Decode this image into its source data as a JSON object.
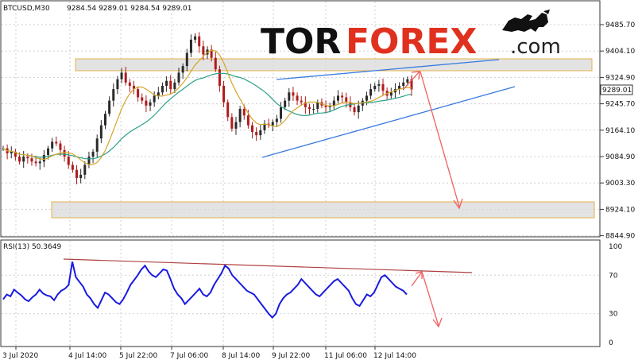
{
  "header": {
    "symbol_timeframe": "BTCUSD,M30",
    "ohlc": "9284.54 9289.01 9284.54 9289.01",
    "rsi_label": "RSI(13) 50.3649"
  },
  "logo": {
    "part1": "TOR",
    "part2": "FOREX",
    "part3": ".com"
  },
  "colors": {
    "candle_up": "#2a2a2a",
    "candle_down": "#b21a1a",
    "ma_fast": "#d4a52a",
    "ma_slow": "#2aa08a",
    "trendline": "#3b7be0",
    "forecast_arrow": "#f06060",
    "rsi_line": "#1a1ae0",
    "rsi_trendline": "#b04040",
    "zone_fill": "#d9d9d9",
    "zone_border": "#e3b04b",
    "logo_dark": "#111111",
    "logo_red": "#e0301e"
  },
  "current_price": "9289.01",
  "chart_data": [
    {
      "type": "line",
      "title": "BTCUSD,M30",
      "y_ticks": [
        "9485.70",
        "9404.10",
        "9324.90",
        "9245.70",
        "9164.10",
        "9084.90",
        "9003.30",
        "8924.10",
        "8844.90"
      ],
      "ylim": [
        8844.9,
        9520
      ],
      "x_ticks": [
        "3 Jul 2020",
        "4 Jul 14:00",
        "5 Jul 22:00",
        "7 Jul 06:00",
        "8 Jul 14:00",
        "9 Jul 22:00",
        "11 Jul 06:00",
        "12 Jul 14:00"
      ],
      "series": [
        {
          "values": [
            9110,
            9095,
            9100,
            9085,
            9070,
            9085,
            9080,
            9070,
            9065,
            9070,
            9090,
            9110,
            9130,
            9125,
            9105,
            9085,
            9060,
            9045,
            9020,
            9030,
            9060,
            9085,
            9100,
            9140,
            9180,
            9215,
            9255,
            9290,
            9320,
            9340,
            9310,
            9300,
            9290,
            9265,
            9255,
            9240,
            9250,
            9270,
            9280,
            9300,
            9315,
            9290,
            9310,
            9340,
            9360,
            9400,
            9440,
            9450,
            9420,
            9395,
            9410,
            9385,
            9350,
            9300,
            9250,
            9205,
            9170,
            9190,
            9230,
            9210,
            9180,
            9160,
            9150,
            9165,
            9185,
            9180,
            9190,
            9200,
            9235,
            9255,
            9280,
            9270,
            9255,
            9250,
            9235,
            9230,
            9230,
            9250,
            9240,
            9235,
            9240,
            9255,
            9270,
            9265,
            9250,
            9235,
            9220,
            9240,
            9255,
            9270,
            9290,
            9300,
            9305,
            9285,
            9270,
            9280,
            9290,
            9300,
            9310,
            9320,
            9289
          ]
        }
      ]
    },
    {
      "type": "line",
      "title": "RSI(13) 50.3649",
      "y_ticks": [
        "100",
        "70",
        "30",
        "0"
      ],
      "ylim": [
        0,
        100
      ],
      "series": [
        {
          "values": [
            45,
            50,
            48,
            55,
            52,
            49,
            45,
            43,
            47,
            50,
            55,
            51,
            49,
            48,
            44,
            50,
            54,
            56,
            60,
            84,
            68,
            63,
            58,
            50,
            46,
            40,
            36,
            44,
            52,
            50,
            46,
            42,
            40,
            45,
            52,
            60,
            65,
            70,
            76,
            80,
            74,
            70,
            68,
            72,
            76,
            75,
            66,
            56,
            50,
            46,
            40,
            44,
            48,
            52,
            56,
            50,
            48,
            52,
            60,
            66,
            72,
            80,
            77,
            70,
            66,
            62,
            58,
            54,
            52,
            50,
            45,
            40,
            35,
            30,
            26,
            30,
            40,
            46,
            50,
            52,
            56,
            60,
            66,
            62,
            58,
            54,
            50,
            48,
            52,
            56,
            60,
            64,
            66,
            62,
            58,
            54,
            46,
            40,
            38,
            44,
            50,
            48,
            52,
            60,
            68,
            70,
            66,
            62,
            58,
            56,
            54,
            50
          ]
        }
      ]
    }
  ]
}
